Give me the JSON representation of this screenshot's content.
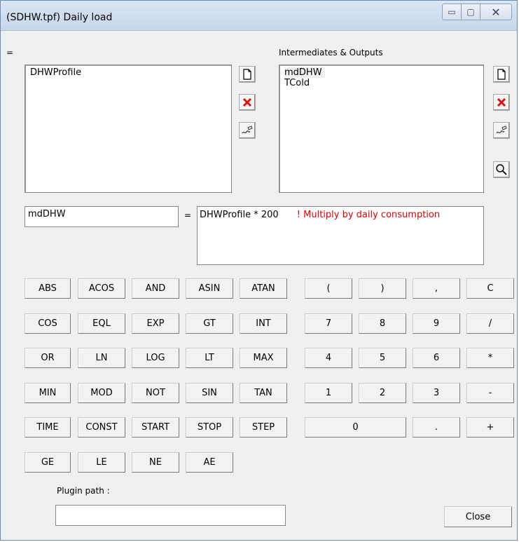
{
  "window": {
    "title": "(SDHW.tpf) Daily load",
    "controls": {
      "minimize": "▭",
      "maximize": "▢",
      "close": "✕"
    }
  },
  "left_panel": {
    "label": "=",
    "items": [
      "DHWProfile"
    ]
  },
  "right_panel": {
    "label": "Intermediates & Outputs",
    "items": [
      "mdDHW",
      "TCold"
    ]
  },
  "icons": {
    "new": "document-icon",
    "delete": "red-x-icon",
    "edit": "edit-pen-icon",
    "search": "magnifier-icon"
  },
  "expression": {
    "name": "mdDHW",
    "equals": "=",
    "formula": "DHWProfile * 200",
    "comment": "! Multiply by daily consumption"
  },
  "functions": [
    [
      "ABS",
      "ACOS",
      "AND",
      "ASIN",
      "ATAN"
    ],
    [
      "COS",
      "EQL",
      "EXP",
      "GT",
      "INT"
    ],
    [
      "OR",
      "LN",
      "LOG",
      "LT",
      "MAX"
    ],
    [
      "MIN",
      "MOD",
      "NOT",
      "SIN",
      "TAN"
    ],
    [
      "TIME",
      "CONST",
      "START",
      "STOP",
      "STEP"
    ],
    [
      "GE",
      "LE",
      "NE",
      "AE"
    ]
  ],
  "keypad": [
    [
      "(",
      ")",
      ",",
      "C"
    ],
    [
      "7",
      "8",
      "9",
      "/"
    ],
    [
      "4",
      "5",
      "6",
      "*"
    ],
    [
      "1",
      "2",
      "3",
      "-"
    ],
    [
      "0",
      ".",
      "+"
    ]
  ],
  "plugin": {
    "label": "Plugin path :",
    "value": ""
  },
  "close_button": "Close"
}
